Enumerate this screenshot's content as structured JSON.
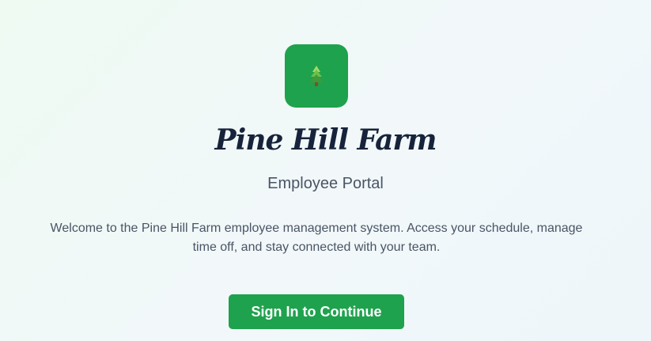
{
  "brand": {
    "logo_icon": "pine-tree-icon",
    "name": "Pine Hill Farm",
    "subtitle": "Employee Portal"
  },
  "welcome_text": "Welcome to the Pine Hill Farm employee management system. Access your schedule, manage time off, and stay connected with your team.",
  "actions": {
    "sign_in_label": "Sign In to Continue"
  },
  "colors": {
    "accent_green": "#1fa24d",
    "brand_text": "#16233a",
    "body_text": "#4a5565"
  }
}
